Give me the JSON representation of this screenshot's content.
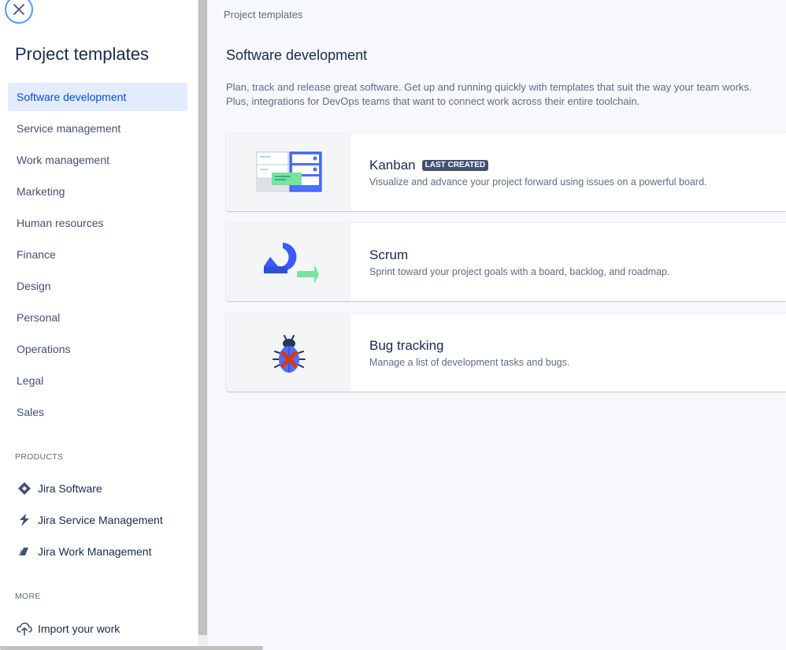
{
  "sidebar": {
    "title": "Project templates",
    "categories": [
      {
        "label": "Software development",
        "active": true
      },
      {
        "label": "Service management"
      },
      {
        "label": "Work management"
      },
      {
        "label": "Marketing"
      },
      {
        "label": "Human resources"
      },
      {
        "label": "Finance"
      },
      {
        "label": "Design"
      },
      {
        "label": "Personal"
      },
      {
        "label": "Operations"
      },
      {
        "label": "Legal"
      },
      {
        "label": "Sales"
      }
    ],
    "products_label": "PRODUCTS",
    "products": [
      {
        "label": "Jira Software",
        "icon": "jira-software-icon"
      },
      {
        "label": "Jira Service Management",
        "icon": "jira-service-management-icon"
      },
      {
        "label": "Jira Work Management",
        "icon": "jira-work-management-icon"
      }
    ],
    "more_label": "MORE",
    "more": [
      {
        "label": "Import your work",
        "icon": "cloud-upload-icon"
      }
    ]
  },
  "main": {
    "breadcrumb": "Project templates",
    "title": "Software development",
    "description": "Plan, track and release great software. Get up and running quickly with templates that suit the way your team works. Plus, integrations for DevOps teams that want to connect work across their entire toolchain.",
    "templates": [
      {
        "name": "Kanban",
        "badge": "LAST CREATED",
        "description": "Visualize and advance your project forward using issues on a powerful board."
      },
      {
        "name": "Scrum",
        "description": "Sprint toward your project goals with a board, backlog, and roadmap."
      },
      {
        "name": "Bug tracking",
        "description": "Manage a list of development tasks and bugs."
      }
    ]
  },
  "colors": {
    "accent": "#0052cc",
    "active_bg": "#e3ecfc",
    "text": "#172b4d",
    "subtle_text": "#5e6c84"
  }
}
